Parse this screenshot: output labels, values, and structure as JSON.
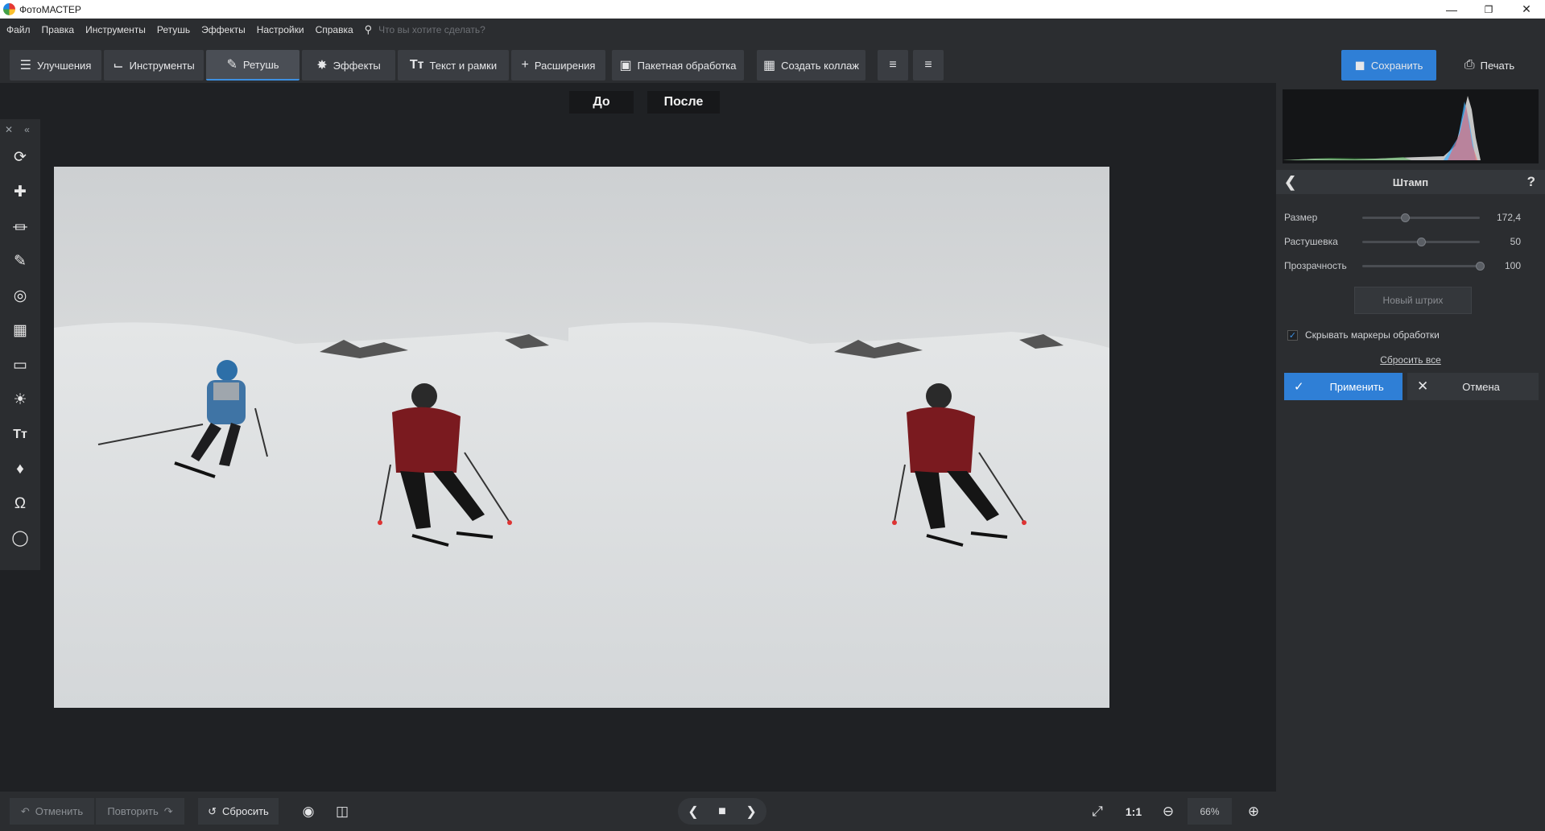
{
  "window": {
    "title": "ФотоМАСТЕР",
    "minimize": "—",
    "maximize": "❐",
    "close": "✕"
  },
  "menu": {
    "items": [
      "Файл",
      "Правка",
      "Инструменты",
      "Ретушь",
      "Эффекты",
      "Настройки",
      "Справка"
    ],
    "search_placeholder": "Что вы хотите сделать?"
  },
  "toolbar": {
    "tabs": [
      {
        "label": "Улучшения",
        "icon": "sliders-icon"
      },
      {
        "label": "Инструменты",
        "icon": "crop-icon"
      },
      {
        "label": "Ретушь",
        "icon": "brush-icon",
        "active": true
      },
      {
        "label": "Эффекты",
        "icon": "magic-wand-icon"
      },
      {
        "label": "Текст и рамки",
        "icon": "text-icon"
      },
      {
        "label": "Расширения",
        "icon": "plus-icon"
      }
    ],
    "batch_label": "Пакетная обработка",
    "collage_label": "Создать коллаж",
    "save_label": "Сохранить",
    "print_label": "Печать"
  },
  "canvas": {
    "before_label": "До",
    "after_label": "После"
  },
  "stamp_panel": {
    "title": "Штамп",
    "sliders": [
      {
        "label": "Размер",
        "value": "172,4",
        "position": 0.36
      },
      {
        "label": "Растушевка",
        "value": "50",
        "position": 0.5
      },
      {
        "label": "Прозрачность",
        "value": "100",
        "position": 1.0
      }
    ],
    "new_stroke_label": "Новый штрих",
    "hide_markers_label": "Скрывать маркеры обработки",
    "hide_markers_checked": true,
    "reset_all_label": "Сбросить все",
    "apply_label": "Применить",
    "cancel_label": "Отмена"
  },
  "bottom": {
    "undo_label": "Отменить",
    "redo_label": "Повторить",
    "reset_label": "Сбросить",
    "one_to_one_label": "1:1",
    "zoom_value": "66%"
  },
  "colors": {
    "accent": "#2f7fd6",
    "background": "#1f2124",
    "panel": "#2b2d30"
  }
}
